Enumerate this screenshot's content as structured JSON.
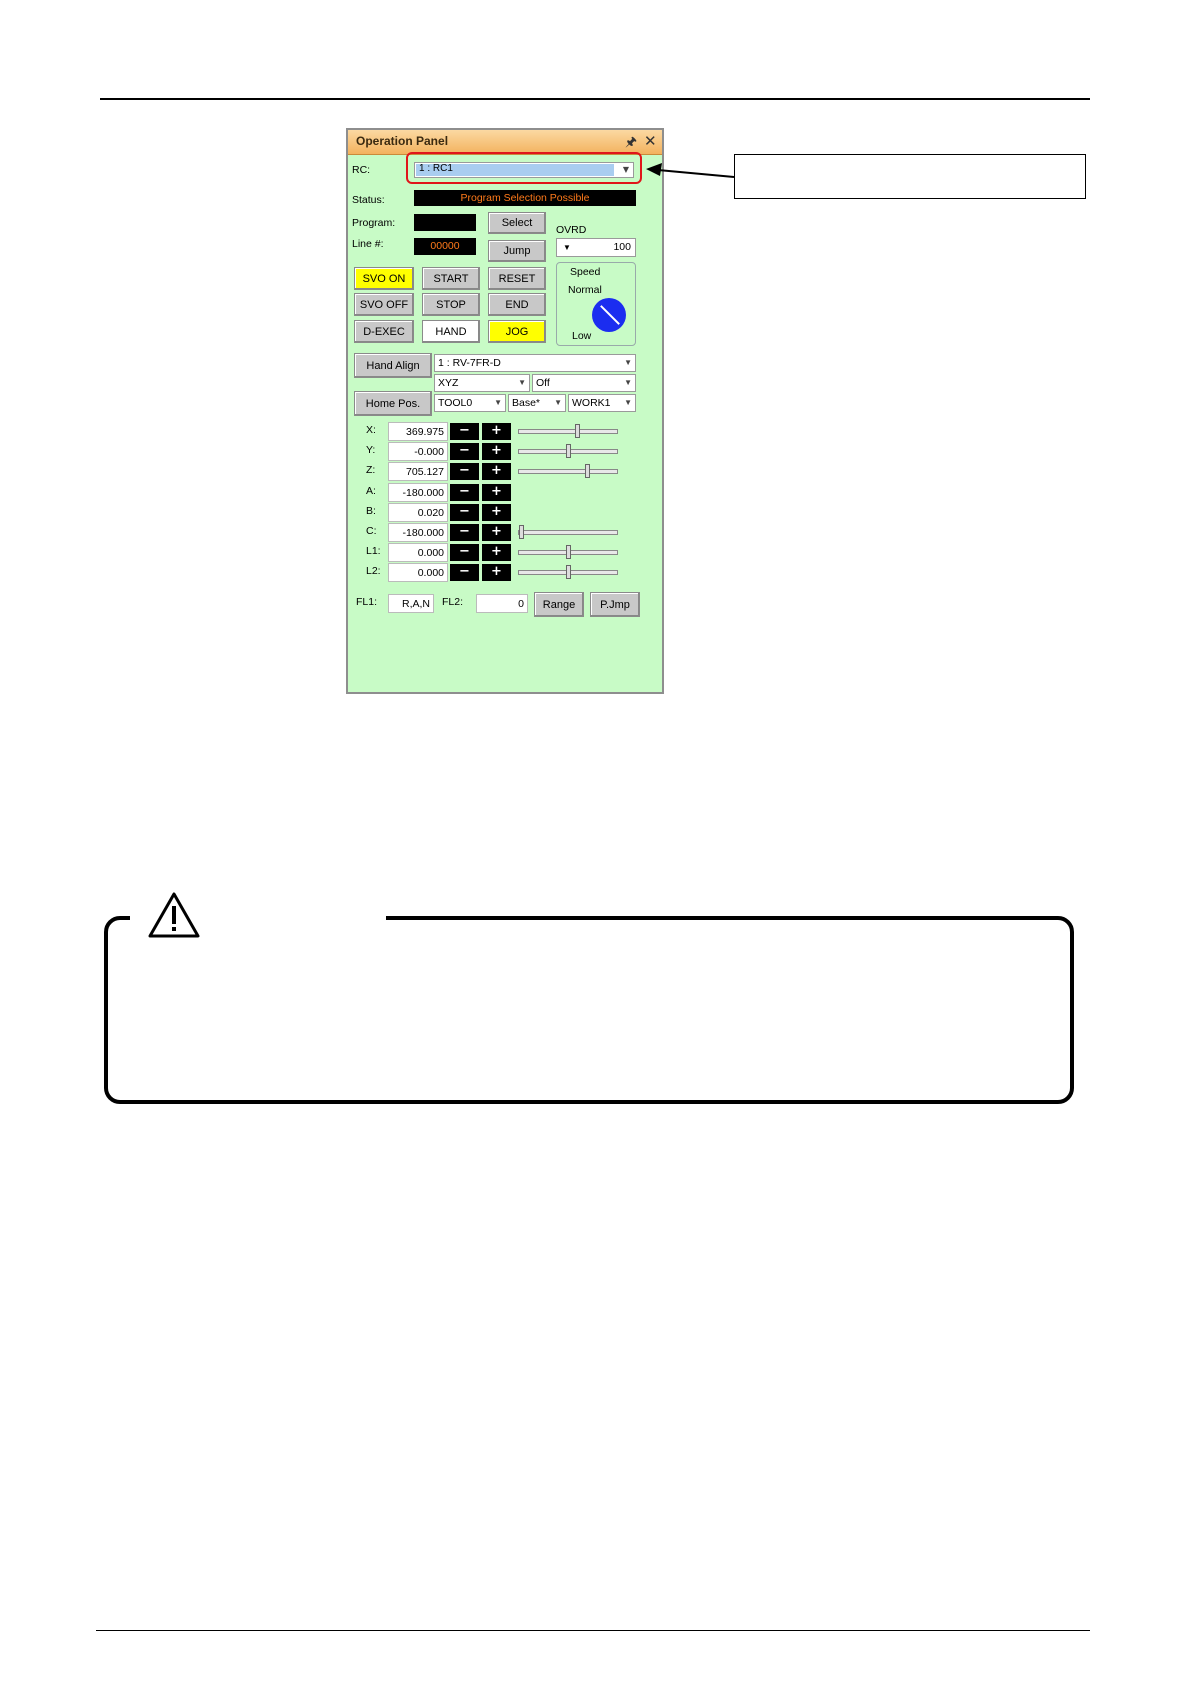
{
  "panel": {
    "title": "Operation Panel",
    "rc_label": "RC:",
    "rc_value": "1 : RC1",
    "status_label": "Status:",
    "status_value": "Program Selection Possible",
    "program_label": "Program:",
    "line_label": "Line #:",
    "line_value": "00000",
    "select_label": "Select",
    "jump_label": "Jump",
    "ovrd_label": "OVRD",
    "ovrd_value": "100",
    "svo_on_label": "SVO ON",
    "svo_off_label": "SVO OFF",
    "d_exec_label": "D-EXEC",
    "start_label": "START",
    "stop_label": "STOP",
    "hand_label": "HAND",
    "reset_label": "RESET",
    "end_label": "END",
    "jog_label": "JOG",
    "speed_label": "Speed",
    "speed_normal": "Normal",
    "speed_low": "Low",
    "hand_align_label": "Hand Align",
    "home_pos_label": "Home Pos.",
    "robot_value": "1 : RV-7FR-D",
    "coord_value": "XYZ",
    "mode_value": "Off",
    "tool_value": "TOOL0",
    "base_value": "Base*",
    "work_value": "WORK1",
    "axes": [
      {
        "label": "X:",
        "value": "369.975",
        "slider": 0.6
      },
      {
        "label": "Y:",
        "value": "-0.000",
        "slider": 0.5
      },
      {
        "label": "Z:",
        "value": "705.127",
        "slider": 0.7
      },
      {
        "label": "A:",
        "value": "-180.000"
      },
      {
        "label": "B:",
        "value": "0.020"
      },
      {
        "label": "C:",
        "value": "-180.000",
        "slider": 0.0
      },
      {
        "label": "L1:",
        "value": "0.000",
        "slider": 0.5
      },
      {
        "label": "L2:",
        "value": "0.000",
        "slider": 0.5
      }
    ],
    "minus_label": "−",
    "plus_label": "+",
    "fl1_label": "FL1:",
    "fl1_value": "R,A,N",
    "fl2_label": "FL2:",
    "fl2_value": "0",
    "range_label": "Range",
    "pjmp_label": "P.Jmp"
  },
  "colors": {
    "panel_bg": "#c8fbc6",
    "highlight": "#e0151a",
    "yellow": "#ffff00",
    "status_text": "#ff7a1a",
    "dial": "#1b2df0"
  }
}
